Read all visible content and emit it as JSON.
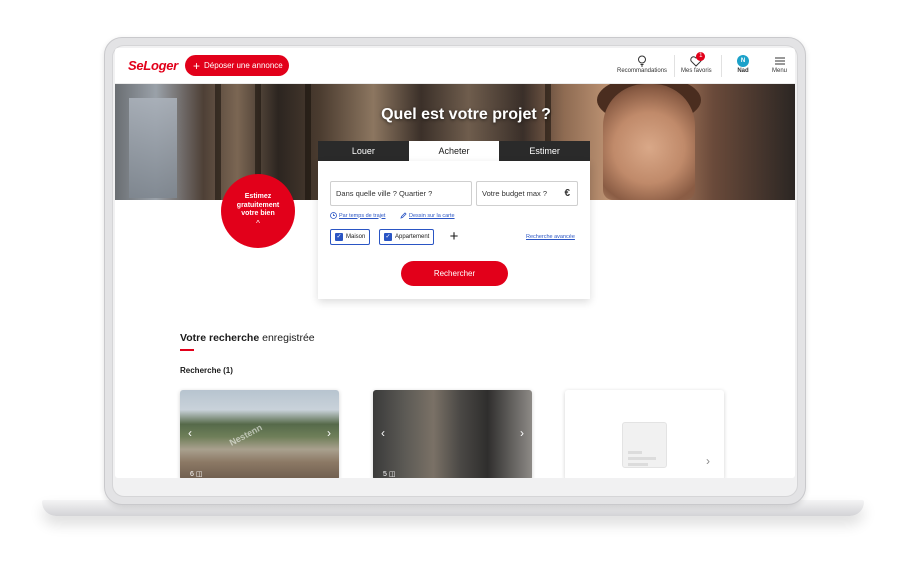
{
  "header": {
    "logo": "SeLoger",
    "deposit_label": "Déposer une annonce",
    "recommendations_label": "Recommandations",
    "favorites_label": "Mes favoris",
    "favorites_count": "1",
    "user_initial": "N",
    "user_name": "Nad",
    "menu_label": "Menu"
  },
  "hero": {
    "title": "Quel est votre projet ?"
  },
  "tabs": [
    {
      "label": "Louer"
    },
    {
      "label": "Acheter"
    },
    {
      "label": "Estimer"
    }
  ],
  "search": {
    "city_placeholder": "Dans quelle ville ? Quartier ?",
    "budget_placeholder": "Votre budget max ?",
    "currency": "€",
    "travel_time_link": "Par temps de trajet",
    "draw_map_link": "Dessin sur la carte",
    "property_types": [
      {
        "label": "Maison"
      },
      {
        "label": "Appartement"
      }
    ],
    "add_label": "+",
    "advanced_link": "Recherche avancée",
    "submit_label": "Rechercher"
  },
  "estimate": {
    "line1": "Estimez",
    "line2": "gratuitement",
    "line3": "votre bien",
    "chevron": "^"
  },
  "saved": {
    "title_bold": "Votre recherche",
    "title_rest": " enregistrée",
    "subtitle": "Recherche (1)"
  },
  "cards": [
    {
      "photo_count": "6",
      "watermark": "Nestenn"
    },
    {
      "photo_count": "5"
    }
  ],
  "colors": {
    "brand": "#e2001a",
    "link": "#2a55c4",
    "avatar": "#1ba1c9"
  }
}
